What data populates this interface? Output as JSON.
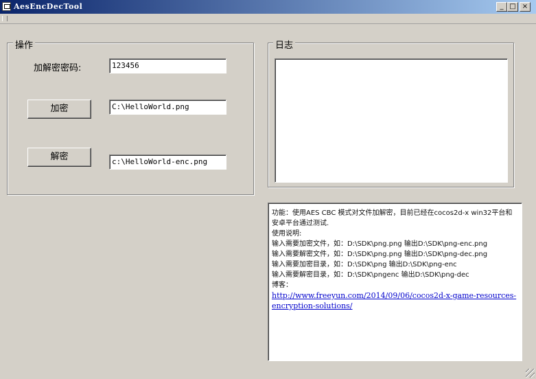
{
  "window": {
    "title": "AesEncDecTool"
  },
  "caption_buttons": {
    "minimize": "_",
    "maximize": "□",
    "close": "×"
  },
  "operations": {
    "group_label": "操作",
    "password_label": "加解密密码:",
    "password_value": "123456",
    "encrypt_button": "加密",
    "encrypt_path": "C:\\HelloWorld.png",
    "decrypt_button": "解密",
    "decrypt_path": "c:\\HelloWorld-enc.png"
  },
  "log": {
    "group_label": "日志",
    "content": ""
  },
  "info": {
    "line1": "功能：使用AES CBC 模式对文件加解密，目前已经在cocos2d-x win32平台和安卓平台通过测试.",
    "line2": "使用说明:",
    "line3": "输入需要加密文件，如：D:\\SDK\\png.png 输出D:\\SDK\\png-enc.png",
    "line4": "输入需要解密文件，如：D:\\SDK\\png.png 输出D:\\SDK\\png-dec.png",
    "line5": "输入需要加密目录，如：D:\\SDK\\png 输出D:\\SDK\\png-enc",
    "line6": "输入需要解密目录，如：D:\\SDK\\pngenc 输出D:\\SDK\\png-dec",
    "blog_label": "博客：",
    "blog_url": "http://www.freeyun.com/2014/09/06/cocos2d-x-game-resources-encryption-solutions/"
  }
}
